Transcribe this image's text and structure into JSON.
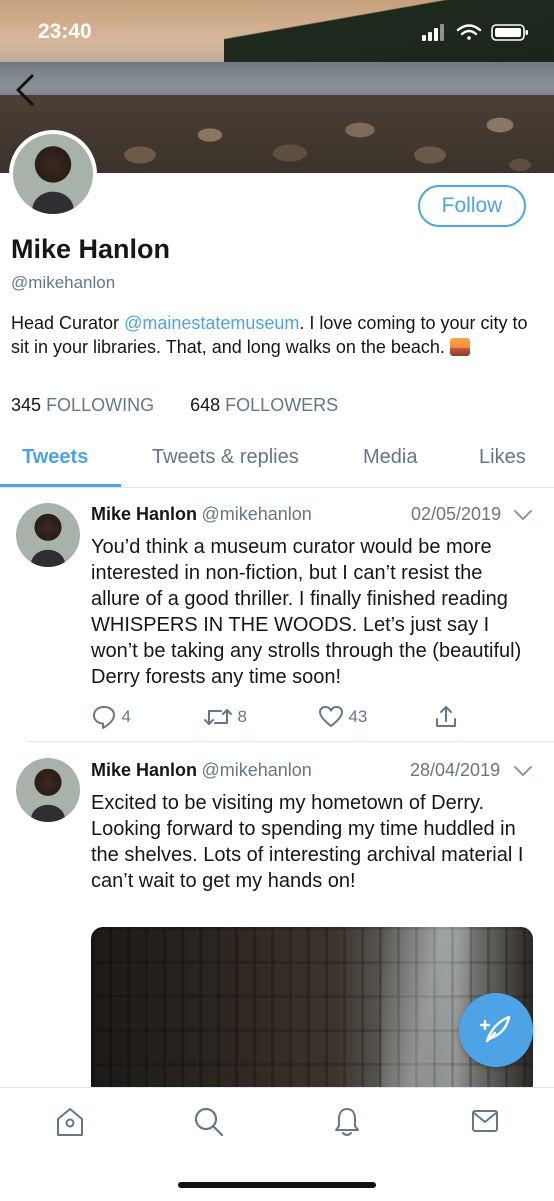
{
  "status_bar": {
    "time": "23:40"
  },
  "profile": {
    "name": "Mike Hanlon",
    "handle": "@mikehanlon",
    "follow_label": "Follow",
    "bio_prefix": "Head Curator ",
    "bio_mention": "@mainestatemuseum",
    "bio_suffix": ". I love coming to your city to sit in your libraries. That, and long walks on the beach. ",
    "following_count": "345",
    "following_label": "FOLLOWING",
    "followers_count": "648",
    "followers_label": "FOLLOWERS"
  },
  "tabs": [
    "Tweets",
    "Tweets & replies",
    "Media",
    "Likes"
  ],
  "tweets": [
    {
      "name": "Mike Hanlon",
      "handle": "@mikehanlon",
      "date": "02/05/2019",
      "text": "You’d think a museum curator would be more interested in non-fiction, but I can’t resist the allure of a good thriller. I finally finished reading WHISPERS IN THE WOODS. Let’s just say I won’t be taking any strolls through the (beautiful) Derry forests any time soon!",
      "replies": "4",
      "retweets": "8",
      "likes": "43"
    },
    {
      "name": "Mike Hanlon",
      "handle": "@mikehanlon",
      "date": "28/04/2019",
      "text": "Excited to be visiting my hometown of Derry. Looking forward to spending my time huddled in the shelves. Lots of interesting archival material I can’t wait to get my hands on!"
    }
  ],
  "icons": {
    "back": "chevron-left-icon",
    "compose": "compose-tweet-icon",
    "tabbar": [
      "home-icon",
      "search-icon",
      "bell-icon",
      "mail-icon"
    ]
  },
  "colors": {
    "accent": "#4da3e5",
    "secondary_text": "#657786",
    "divider": "#e1e8ed"
  }
}
